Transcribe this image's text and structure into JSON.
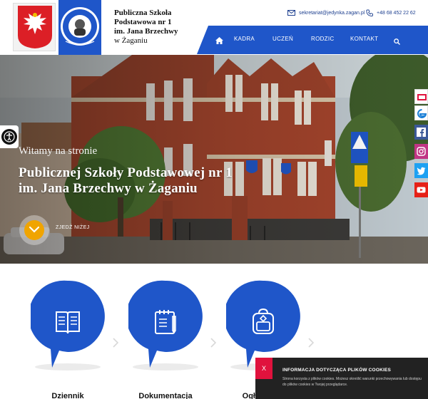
{
  "header": {
    "school_name": {
      "line1": "Publiczna Szkoła",
      "line2": "Podstawowa nr 1",
      "line3": "im. Jana Brzechwy",
      "line4": "w Żaganiu"
    },
    "contact": {
      "email": "sekretariat@jedynka.zagan.pl",
      "phone": "+48 68 452 22 62"
    },
    "nav": {
      "items": [
        "KADRA",
        "UCZEŃ",
        "RODZIC",
        "KONTAKT"
      ]
    }
  },
  "hero": {
    "welcome": "Witamy na stronie",
    "title_line1": "Publicznej Szkoły Podstawowej nr 1",
    "title_line2": "im. Jana Brzechwy w Żaganiu",
    "scroll_label": "ZJEDŹ NIŻEJ"
  },
  "features": [
    {
      "label": "Dziennik",
      "icon": "book-icon"
    },
    {
      "label": "Dokumentacja",
      "icon": "notebook-icon"
    },
    {
      "label": "Ogłoszenia",
      "icon": "backpack-icon"
    }
  ],
  "social": [
    "blog-icon",
    "edge-icon",
    "facebook-icon",
    "instagram-icon",
    "twitter-icon",
    "youtube-icon"
  ],
  "cookie": {
    "close": "X",
    "title": "INFORMACJA DOTYCZĄCA PLIKÓW COOKIES",
    "text": "Strona korzysta z plików cookies. Możesz określić warunki przechowywania lub dostępu do plików cookies w Twojej przeglądarce."
  },
  "colors": {
    "nav_blue": "#1f56c9",
    "feature_blue": "#1f56c9",
    "accent_orange": "#f0a400",
    "cookie_red": "#e0123d"
  }
}
